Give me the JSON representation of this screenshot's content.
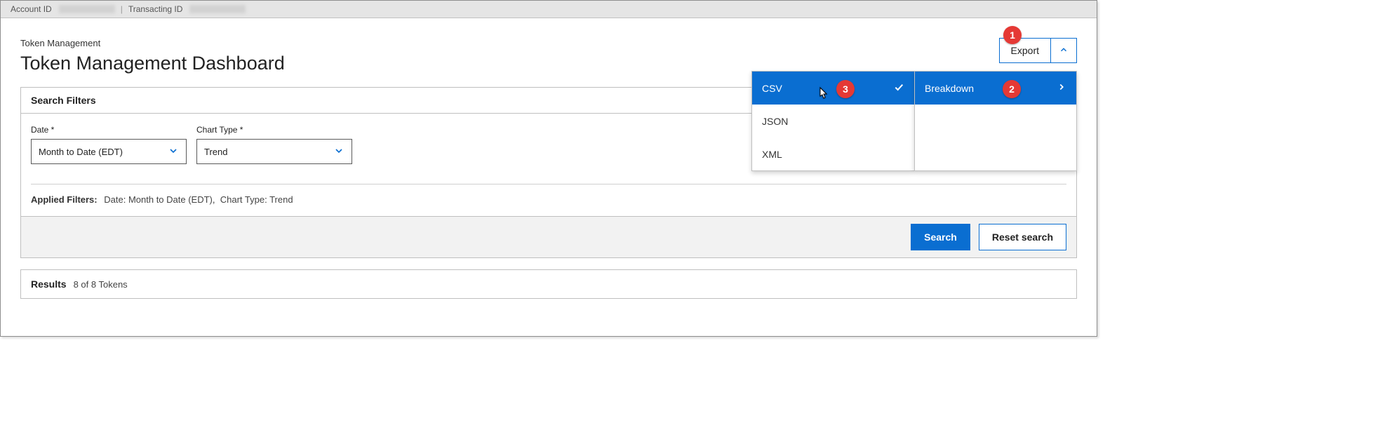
{
  "header": {
    "account_label": "Account ID",
    "transacting_label": "Transacting ID"
  },
  "breadcrumb": "Token Management",
  "page_title": "Token Management Dashboard",
  "export": {
    "label": "Export",
    "type_item": "Breakdown",
    "formats": [
      "CSV",
      "JSON",
      "XML"
    ],
    "selected_format": "CSV"
  },
  "filters_panel": {
    "title": "Search Filters",
    "date": {
      "label": "Date *",
      "value": "Month to Date (EDT)"
    },
    "chart_type": {
      "label": "Chart Type *",
      "value": "Trend"
    },
    "applied_label": "Applied Filters:",
    "applied": [
      {
        "name": "Date",
        "value": "Month to Date (EDT)"
      },
      {
        "name": "Chart Type",
        "value": "Trend"
      }
    ],
    "search_btn": "Search",
    "reset_btn": "Reset search"
  },
  "results": {
    "title": "Results",
    "count_text": "8 of 8 Tokens"
  },
  "annotations": {
    "b1": "1",
    "b2": "2",
    "b3": "3"
  }
}
